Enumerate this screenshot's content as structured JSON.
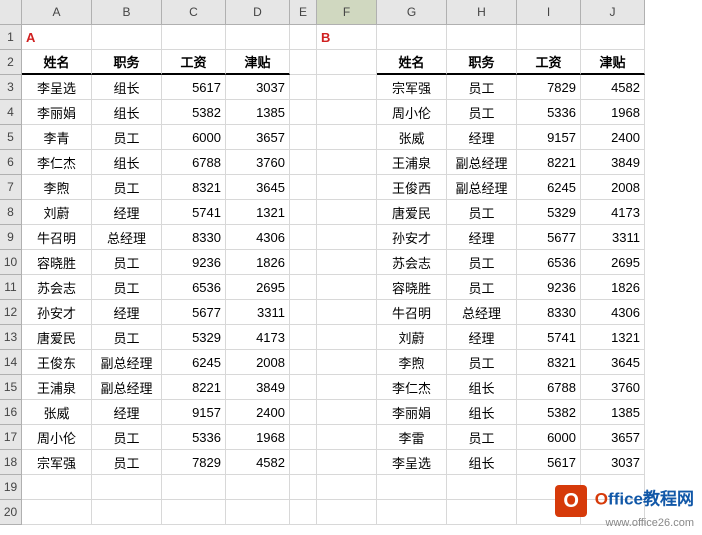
{
  "columns": [
    "",
    "A",
    "B",
    "C",
    "D",
    "E",
    "F",
    "G",
    "H",
    "I",
    "J"
  ],
  "row_labels": [
    "1",
    "2",
    "3",
    "4",
    "5",
    "6",
    "7",
    "8",
    "9",
    "10",
    "11",
    "12",
    "13",
    "14",
    "15",
    "16",
    "17",
    "18",
    "19",
    "20"
  ],
  "selected_column": "F",
  "label_A": "A",
  "label_B": "B",
  "headers": {
    "name": "姓名",
    "role": "职务",
    "salary": "工资",
    "allowance": "津贴"
  },
  "left": [
    {
      "name": "李呈选",
      "role": "组长",
      "salary": 5617,
      "allowance": 3037
    },
    {
      "name": "李丽娟",
      "role": "组长",
      "salary": 5382,
      "allowance": 1385
    },
    {
      "name": "李青",
      "role": "员工",
      "salary": 6000,
      "allowance": 3657
    },
    {
      "name": "李仁杰",
      "role": "组长",
      "salary": 6788,
      "allowance": 3760
    },
    {
      "name": "李煦",
      "role": "员工",
      "salary": 8321,
      "allowance": 3645
    },
    {
      "name": "刘蔚",
      "role": "经理",
      "salary": 5741,
      "allowance": 1321
    },
    {
      "name": "牛召明",
      "role": "总经理",
      "salary": 8330,
      "allowance": 4306
    },
    {
      "name": "容晓胜",
      "role": "员工",
      "salary": 9236,
      "allowance": 1826
    },
    {
      "name": "苏会志",
      "role": "员工",
      "salary": 6536,
      "allowance": 2695
    },
    {
      "name": "孙安才",
      "role": "经理",
      "salary": 5677,
      "allowance": 3311
    },
    {
      "name": "唐爱民",
      "role": "员工",
      "salary": 5329,
      "allowance": 4173
    },
    {
      "name": "王俊东",
      "role": "副总经理",
      "salary": 6245,
      "allowance": 2008
    },
    {
      "name": "王浦泉",
      "role": "副总经理",
      "salary": 8221,
      "allowance": 3849
    },
    {
      "name": "张威",
      "role": "经理",
      "salary": 9157,
      "allowance": 2400
    },
    {
      "name": "周小伦",
      "role": "员工",
      "salary": 5336,
      "allowance": 1968
    },
    {
      "name": "宗军强",
      "role": "员工",
      "salary": 7829,
      "allowance": 4582
    }
  ],
  "right": [
    {
      "name": "宗军强",
      "role": "员工",
      "salary": 7829,
      "allowance": 4582
    },
    {
      "name": "周小伦",
      "role": "员工",
      "salary": 5336,
      "allowance": 1968
    },
    {
      "name": "张威",
      "role": "经理",
      "salary": 9157,
      "allowance": 2400
    },
    {
      "name": "王浦泉",
      "role": "副总经理",
      "salary": 8221,
      "allowance": 3849
    },
    {
      "name": "王俊西",
      "role": "副总经理",
      "salary": 6245,
      "allowance": 2008
    },
    {
      "name": "唐爱民",
      "role": "员工",
      "salary": 5329,
      "allowance": 4173
    },
    {
      "name": "孙安才",
      "role": "经理",
      "salary": 5677,
      "allowance": 3311
    },
    {
      "name": "苏会志",
      "role": "员工",
      "salary": 6536,
      "allowance": 2695
    },
    {
      "name": "容晓胜",
      "role": "员工",
      "salary": 9236,
      "allowance": 1826
    },
    {
      "name": "牛召明",
      "role": "总经理",
      "salary": 8330,
      "allowance": 4306
    },
    {
      "name": "刘蔚",
      "role": "经理",
      "salary": 5741,
      "allowance": 1321
    },
    {
      "name": "李煦",
      "role": "员工",
      "salary": 8321,
      "allowance": 3645
    },
    {
      "name": "李仁杰",
      "role": "组长",
      "salary": 6788,
      "allowance": 3760
    },
    {
      "name": "李丽娟",
      "role": "组长",
      "salary": 5382,
      "allowance": 1385
    },
    {
      "name": "李雷",
      "role": "员工",
      "salary": 6000,
      "allowance": 3657
    },
    {
      "name": "李呈选",
      "role": "组长",
      "salary": 5617,
      "allowance": 3037
    }
  ],
  "watermark": {
    "title_highlight": "O",
    "title_rest": "ffice教程网",
    "url": "www.office26.com"
  }
}
